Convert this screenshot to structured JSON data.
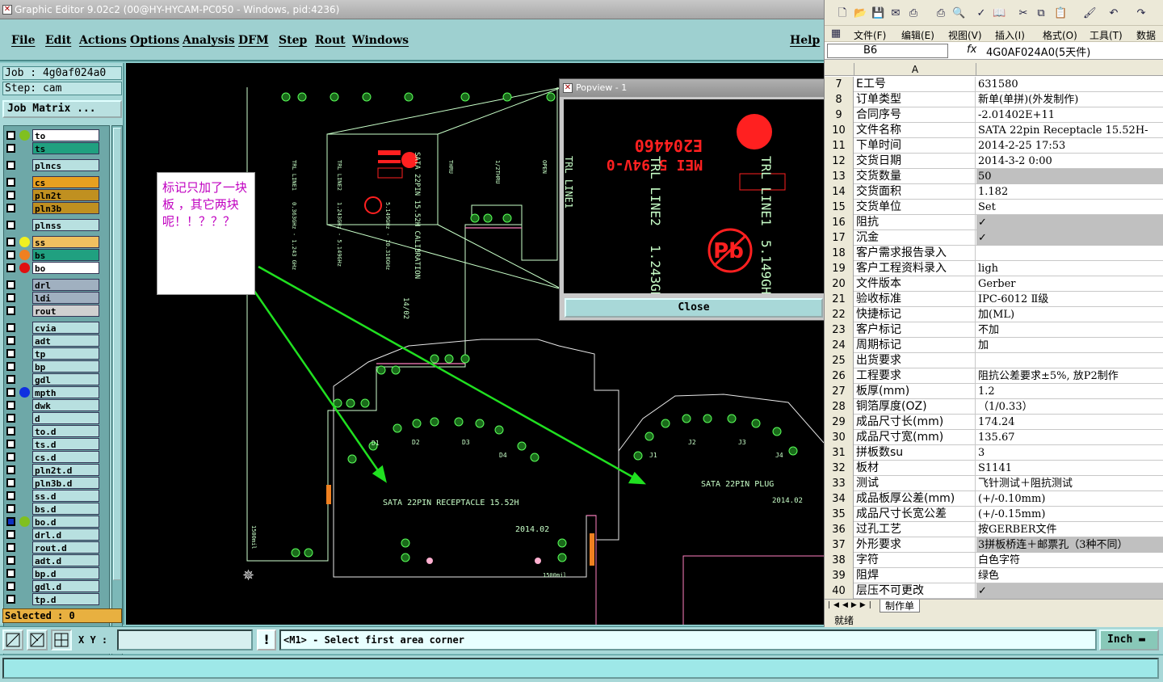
{
  "window": {
    "title": "Graphic Editor 9.02c2 (00@HY-HYCAM-PC050 - Windows, pid:4236)"
  },
  "menu": [
    "File",
    "Edit",
    "Actions",
    "Options",
    "Analysis",
    "DFM",
    "Step",
    "Rout",
    "Windows"
  ],
  "help_label": "Help",
  "job_label": "Job : 4g0af024a0",
  "step_label": "Step: cam",
  "job_matrix_label": "Job Matrix ...",
  "layers": [
    {
      "name": "to",
      "color": "#ffffff",
      "dot": "#80c020"
    },
    {
      "name": "ts",
      "color": "#20a080",
      "dot": ""
    },
    {
      "name": "plncs",
      "color": "#b8e0e0",
      "dot": "",
      "gap": true
    },
    {
      "name": "cs",
      "color": "#e8a020",
      "dot": "",
      "sym": "ꝭ",
      "gap": true
    },
    {
      "name": "pln2t",
      "color": "#c09020",
      "dot": "",
      "sym": "ꝭ"
    },
    {
      "name": "pln3b",
      "color": "#c09020",
      "dot": "",
      "sym": "ꝭ"
    },
    {
      "name": "plnss",
      "color": "#b8e0e0",
      "dot": "",
      "gap": true
    },
    {
      "name": "ss",
      "color": "#f0c060",
      "dot": "#f0f020",
      "gap": true
    },
    {
      "name": "bs",
      "color": "#20a080",
      "dot": "#f08020"
    },
    {
      "name": "bo",
      "color": "#ffffff",
      "dot": "#e01010"
    },
    {
      "name": "drl",
      "color": "#a0b0c0",
      "dot": "",
      "gap": true
    },
    {
      "name": "ldi",
      "color": "#a0b0c0",
      "dot": ""
    },
    {
      "name": "rout",
      "color": "#d0d0d0",
      "dot": ""
    },
    {
      "name": "cvia",
      "color": "#b8e0e0",
      "dot": "",
      "gap": true
    },
    {
      "name": "adt",
      "color": "#b8e0e0",
      "dot": ""
    },
    {
      "name": "tp",
      "color": "#b8e0e0",
      "dot": ""
    },
    {
      "name": "bp",
      "color": "#b8e0e0",
      "dot": ""
    },
    {
      "name": "gdl",
      "color": "#b8e0e0",
      "dot": ""
    },
    {
      "name": "mpth",
      "color": "#b8e0e0",
      "dot": "#1030e0"
    },
    {
      "name": "dwk",
      "color": "#b8e0e0",
      "dot": ""
    },
    {
      "name": "d",
      "color": "#b8e0e0",
      "dot": ""
    },
    {
      "name": "to.d",
      "color": "#b8e0e0",
      "dot": ""
    },
    {
      "name": "ts.d",
      "color": "#b8e0e0",
      "dot": ""
    },
    {
      "name": "cs.d",
      "color": "#b8e0e0",
      "dot": "",
      "sym": "ꝭ"
    },
    {
      "name": "pln2t.d",
      "color": "#b8e0e0",
      "dot": "",
      "sym": "ꝭ"
    },
    {
      "name": "pln3b.d",
      "color": "#b8e0e0",
      "dot": "",
      "sym": "ꝭ"
    },
    {
      "name": "ss.d",
      "color": "#b8e0e0",
      "dot": ""
    },
    {
      "name": "bs.d",
      "color": "#b8e0e0",
      "dot": ""
    },
    {
      "name": "bo.d",
      "color": "#b8e0e0",
      "dot": "#80c020",
      "sym": "⊞",
      "blue": true
    },
    {
      "name": "drl.d",
      "color": "#b8e0e0",
      "dot": ""
    },
    {
      "name": "rout.d",
      "color": "#b8e0e0",
      "dot": ""
    },
    {
      "name": "adt.d",
      "color": "#b8e0e0",
      "dot": ""
    },
    {
      "name": "bp.d",
      "color": "#b8e0e0",
      "dot": ""
    },
    {
      "name": "gdl.d",
      "color": "#b8e0e0",
      "dot": ""
    },
    {
      "name": "tp.d",
      "color": "#b8e0e0",
      "dot": ""
    }
  ],
  "selected_label": "Selected : 0",
  "xy_label": "X Y :",
  "message": "<M1> - Select first area corner",
  "units": "Inch",
  "popview": {
    "title": "Popview - 1",
    "close": "Close"
  },
  "note": "标记只加了一块板 ，其它两块呢！！？？？",
  "board": {
    "receptacle": "SATA 22PIN RECEPTACLE 15.52H",
    "receptacle_date": "2014.02",
    "plug": "SATA 22PIN PLUG",
    "plug_date": "2014.02",
    "calib": "SATA 22PIN 15.52H CALIBRATION",
    "calib_date": "14/02",
    "trl1": "TRL LINE1",
    "trl2": "TRL LINE2",
    "freq1": "0.363GHz - 1.243 GHz",
    "freq2": "1.243GHz - 5.149GHz",
    "freq3": "5.149GHz - 10.310GHz",
    "thru": "THRU",
    "half": "1/2THRU",
    "open": "OPEN",
    "dim1": "1500mil",
    "dim2": "1500mil",
    "pads": [
      "D1",
      "D2",
      "D3",
      "D4",
      "J1",
      "J2",
      "J3",
      "J4"
    ],
    "ul": "E204460",
    "ul2": "MEI 5 94V-0"
  },
  "excel": {
    "menus": [
      "文件(F)",
      "编辑(E)",
      "视图(V)",
      "插入(I)",
      "格式(O)",
      "工具(T)",
      "数据"
    ],
    "cell_ref": "B6",
    "fx": "fx",
    "formula": "4G0AF024A0(5天件)",
    "col_a": "A",
    "rows": [
      [
        "7",
        "E工号",
        "631580",
        false
      ],
      [
        "8",
        "订单类型",
        "新单(单拼)(外发制作)",
        false
      ],
      [
        "9",
        "合同序号",
        "-2.01402E+11",
        false
      ],
      [
        "10",
        "文件名称",
        "SATA 22pin Receptacle 15.52H-",
        false
      ],
      [
        "11",
        "下单时间",
        "2014-2-25 17:53",
        false
      ],
      [
        "12",
        "交货日期",
        "2014-3-2 0:00",
        false
      ],
      [
        "13",
        "交货数量",
        "50",
        true
      ],
      [
        "14",
        "交货面积",
        "1.182",
        false
      ],
      [
        "15",
        "交货单位",
        "Set",
        false
      ],
      [
        "16",
        "阻抗",
        "✓",
        true
      ],
      [
        "17",
        "沉金",
        "✓",
        true
      ],
      [
        "18",
        "客户需求报告录入",
        "",
        false
      ],
      [
        "19",
        "客户工程资料录入",
        "ligh",
        false
      ],
      [
        "20",
        "文件版本",
        "Gerber",
        false
      ],
      [
        "21",
        "验收标准",
        "IPC-6012 Ⅱ级",
        false
      ],
      [
        "22",
        "快捷标记",
        "加(ML)",
        false
      ],
      [
        "23",
        "客户标记",
        "不加",
        false
      ],
      [
        "24",
        "周期标记",
        "加",
        false
      ],
      [
        "25",
        "出货要求",
        "",
        false
      ],
      [
        "26",
        "工程要求",
        "阻抗公差要求±5%, 放P2制作",
        false
      ],
      [
        "27",
        "板厚(mm)",
        "1.2",
        false
      ],
      [
        "28",
        "铜箔厚度(OZ)",
        "（1/0.33）",
        false
      ],
      [
        "29",
        "成品尺寸长(mm)",
        "174.24",
        false
      ],
      [
        "30",
        "成品尺寸宽(mm)",
        "135.67",
        false
      ],
      [
        "31",
        "拼板数su",
        "3",
        false
      ],
      [
        "32",
        "板材",
        "S1141",
        false
      ],
      [
        "33",
        "测试",
        "飞针测试＋阻抗测试",
        false
      ],
      [
        "34",
        "成品板厚公差(mm)",
        "(+/-0.10mm)",
        false
      ],
      [
        "35",
        "成品尺寸长宽公差",
        "(+/-0.15mm)",
        false
      ],
      [
        "36",
        "过孔工艺",
        "按GERBER文件",
        false
      ],
      [
        "37",
        "外形要求",
        "3拼板桥连＋邮票孔（3种不同）",
        true
      ],
      [
        "38",
        "字符",
        "白色字符",
        false
      ],
      [
        "39",
        "阻焊",
        "绿色",
        false
      ],
      [
        "40",
        "层压不可更改",
        "✓",
        true
      ]
    ],
    "sheet_tab": "制作单",
    "status": "就绪"
  }
}
